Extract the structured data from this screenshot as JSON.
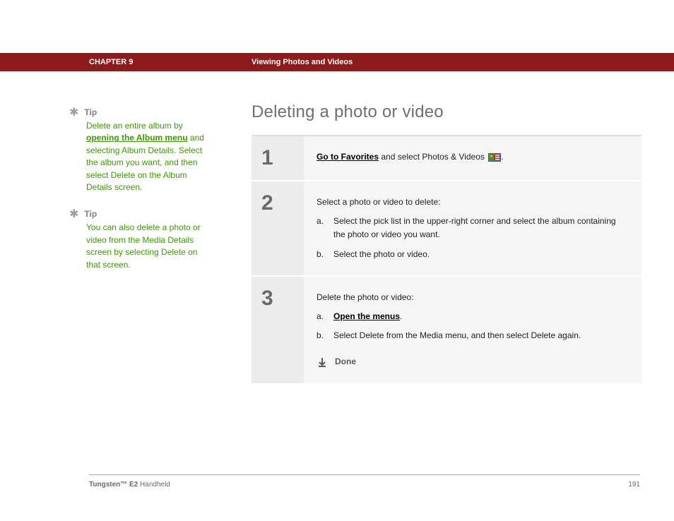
{
  "header": {
    "chapter_label": "CHAPTER 9",
    "chapter_title": "Viewing Photos and Videos"
  },
  "sidebar": {
    "tips": [
      {
        "label": "Tip",
        "pre": "Delete an entire album by ",
        "link": "opening the Album menu",
        "post": " and selecting Album Details. Select the album you want, and then select Delete on the Album Details screen."
      },
      {
        "label": "Tip",
        "pre": "You can also delete a photo or video from the Media Details screen by selecting Delete on that screen.",
        "link": "",
        "post": ""
      }
    ]
  },
  "main": {
    "title": "Deleting a photo or video",
    "steps": [
      {
        "num": "1",
        "link": "Go to Favorites",
        "after_link": " and select Photos & Videos ",
        "tail": "."
      },
      {
        "num": "2",
        "intro": "Select a photo or video to delete:",
        "items": [
          {
            "marker": "a.",
            "text": "Select the pick list in the upper-right corner and select the album containing the photo or video you want."
          },
          {
            "marker": "b.",
            "text": "Select the photo or video."
          }
        ]
      },
      {
        "num": "3",
        "intro": "Delete the photo or video:",
        "items": [
          {
            "marker": "a.",
            "link": "Open the menus",
            "tail": "."
          },
          {
            "marker": "b.",
            "text": "Select Delete from the Media menu, and then select Delete again."
          }
        ],
        "done": "Done"
      }
    ]
  },
  "footer": {
    "product_strong": "Tungsten™ E2",
    "product_rest": " Handheld",
    "page": "191"
  }
}
